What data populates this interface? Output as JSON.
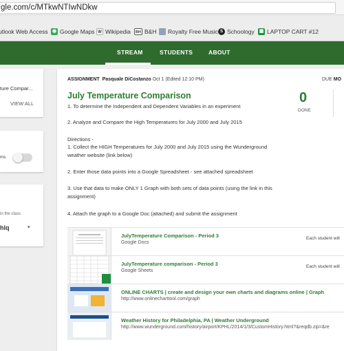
{
  "browser": {
    "url": "gle.com/c/MTkwNTIwNDkw"
  },
  "bookmarks": [
    {
      "label": "utlook Web Access",
      "icon": "outlook-icon",
      "color": "#1f5fa8"
    },
    {
      "label": "Google Maps",
      "icon": "google-maps-icon",
      "color": "#34a853"
    },
    {
      "label": "Wikipedia",
      "icon": "wikipedia-icon",
      "color": "#555555"
    },
    {
      "label": "B&H",
      "icon": "bh-icon",
      "color": "#333333"
    },
    {
      "label": "Royalty Free Music",
      "icon": "folder-icon",
      "color": "#7a8ea5"
    },
    {
      "label": "Schoology",
      "icon": "schoology-icon",
      "color": "#1e88c9"
    },
    {
      "label": "LAPTOP CART #12",
      "icon": "sheets-icon",
      "color": "#1e8e3e"
    }
  ],
  "nav": {
    "tabs": [
      "STREAM",
      "STUDENTS",
      "ABOUT"
    ],
    "active": "STREAM"
  },
  "left": {
    "card1_text": "ture Compar...",
    "card1_link": "VIEW ALL",
    "card2_text": "rns",
    "card3_text": "in the class",
    "card3_code": "hlq"
  },
  "post": {
    "type": "ASSIGNMENT",
    "author": "Pasquale DiCostanzo",
    "date": "Oct 1 (Edited 12:10 PM)",
    "due_label": "DUE",
    "due_value": "MO",
    "title": "July Temperature Comparison",
    "done_count": "0",
    "done_label": "DONE",
    "lines": [
      "1. To determine the Independent and Dependent Variables in an experiment",
      "2. Analyze and Compare the High Temperatures for July 2000 and July 2015",
      "Directions -",
      "1. Collect the HIGH Temperatures for July 2000 and July 2015 using the Wunderground",
      "weather website (link below)",
      "2. Enter those data points into a Google Spreadsheet - see attached spreadsheet",
      "3. Use that data to make ONLY 1 Graph with both sets of data points (using the link in this",
      "assignment)",
      "4. Attach the graph to a Google Doc (attached) and submit the assignment"
    ],
    "attachments": [
      {
        "name": "JulyTemperature Comparison - Period 3",
        "sub": "Google Docs",
        "side": "Each student will"
      },
      {
        "name": "JulyTemperature comparison - Period 3",
        "sub": "Google Sheets",
        "side": "Each student will"
      },
      {
        "name": "ONLINE CHARTS | create and design your own charts and diagrams online | Graph",
        "sub": "http://www.onlinecharttool.com/graph",
        "side": ""
      },
      {
        "name": "Weather History for Philadelphia, PA | Weather Underground",
        "sub": "http://www.wunderground.com/history/airport/KPHL/2014/1/3/CustomHistory.html?&reqdb.zip=&re",
        "side": ""
      }
    ]
  }
}
